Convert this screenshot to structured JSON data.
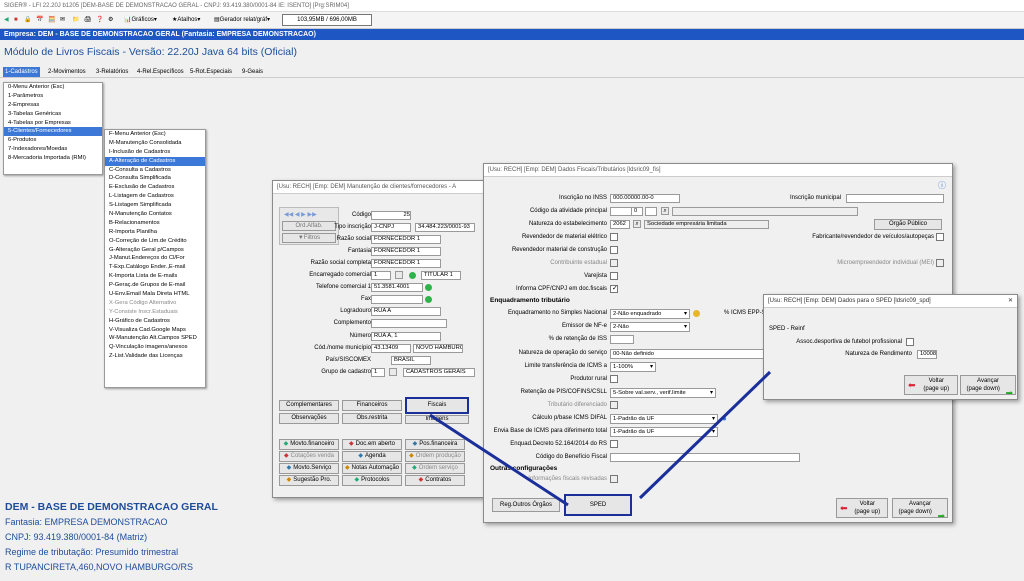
{
  "window_title": "SIGER® - LFI 22.20J b1205 [DEM-BASE DE DEMONSTRACAO GERAL - CNPJ: 93.419.380/0001-84 IE: ISENTO] [Prg:SRIM04]",
  "toolbar": {
    "graficos": "Gráficos",
    "atalhos": "Atalhos",
    "gerador": "Gerador relat/gráf",
    "memory": "103,95MB / 696,00MB"
  },
  "empresa_bar": "Empresa:  DEM - BASE DE DEMONSTRACAO GERAL (Fantasia: EMPRESA DEMONSTRACAO)",
  "module_title": "Módulo de Livros Fiscais - Versão: 22.20J Java 64 bits (Oficial)",
  "menubar": [
    "1-Cadastros",
    "2-Movimentos",
    "3-Relatórios",
    "4-Rel.Específicos",
    "5-Rot.Especiais",
    "9-Geais"
  ],
  "menu1": [
    "0-Menu Anterior (Esc)",
    "1-Parâmetros",
    "2-Empresas",
    "3-Tabelas Genéricas",
    "4-Tabelas por Empresas",
    "5-Clientes/Fornecedores",
    "6-Produtos",
    "7-Indexadores/Moedas",
    "8-Mercadoria Importada (RMI)"
  ],
  "menu2": [
    "F-Menu Anterior (Esc)",
    "M-Manutenção Consolidada",
    "I-Inclusão de Cadastros",
    "A-Alteração de Cadastros",
    "C-Consulta a Cadastros",
    "D-Consulta Simplificada",
    "E-Exclusão de Cadastros",
    "L-Listagem de Cadastros",
    "S-Listagem Simplificada",
    "N-Manutenção Contatos",
    "B-Relacionamentos",
    "R-Importa Planilha",
    "O-Correção de Lim.de Crédito",
    "G-Alteração Geral p/Campos",
    "J-Manut.Endereços do Cl/For",
    "T-Exp.Catálogo Ender.,E-mail",
    "K-Importa Lista de E-mails",
    "P-Geraç.de Grupos de E-mail",
    "U-Env.Email Mala Direta HTML",
    "X-Gera Código Alternativo",
    "Y-Consiste Inscr.Estaduais",
    "H-Gráfico de Cadastros",
    "V-Visualiza Cad.Google Maps",
    "W-Manutenção Alt.Campos SPED",
    "Q-Vinculação imagens/anexos",
    "Z-List.Validade das Licenças"
  ],
  "info": {
    "name": "DEM - BASE DE DEMONSTRACAO GERAL",
    "fantasia": "Fantasia: EMPRESA DEMONSTRACAO",
    "cnpj": "CNPJ: 93.419.380/0001-84 (Matriz)",
    "regime": "Regime de tributação: Presumido trimestral",
    "endereco": "R TUPANCIRETA,460,NOVO HAMBURGO/RS"
  },
  "w1": {
    "title": "[Usu: RECH] [Emp: DEM] Manutenção de clientes/fornecedores - A",
    "ord_alfab": "Ord.Alfab.",
    "filtros": "Filtros",
    "fields": [
      {
        "label": "Código",
        "value": "25"
      },
      {
        "label": "Tipo inscrição",
        "value": "J-CNPJ",
        "value2": "34.484.223/0001-93"
      },
      {
        "label": "Razão social",
        "value": "FORNECEDOR 1"
      },
      {
        "label": "Fantasia",
        "value": "FORNECEDOR 1"
      },
      {
        "label": "Razão social completa",
        "value": "FORNECEDOR 1"
      },
      {
        "label": "Encarregado comercial",
        "value": "1",
        "value2": "TITULAR 1"
      },
      {
        "label": "Telefone comercial 1",
        "value": "51.3581.4001"
      },
      {
        "label": "Fax",
        "value": ""
      },
      {
        "label": "Logradouro",
        "value": "RUA A"
      },
      {
        "label": "Complemento",
        "value": ""
      },
      {
        "label": "Número",
        "value": "RUA A, 1"
      },
      {
        "label": "Cód./nome município",
        "value": "43.13409",
        "value2": "NOVO HAMBURGO"
      },
      {
        "label": "País/SISCOMEX",
        "value": "BRASIL"
      },
      {
        "label": "Grupo de cadastro",
        "value": "1",
        "value2": "CADASTROS GERAIS"
      }
    ],
    "tabs1": [
      "Complementares",
      "Financeiros",
      "Fiscais"
    ],
    "tabs2": [
      "Observações",
      "Obs.restrita",
      "Imagens"
    ],
    "actions": [
      [
        "Movto.financeiro",
        "Doc.em aberto",
        "Pos.financeira"
      ],
      [
        "Cotações venda",
        "Agenda",
        "Ordem produção"
      ],
      [
        "Movto.Serviço",
        "Notas Automação",
        "Ordem serviço"
      ],
      [
        "Sugestão Pro.",
        "Protocolos",
        "Contratos"
      ]
    ]
  },
  "w2": {
    "title": "[Usu: RECH] [Emp: DEM] Dados Fiscais/Tributários [ldsric09_fis]",
    "inss_label": "Inscrição no INSS",
    "inss_value": "000.00000.00-0",
    "insc_mun_label": "Inscrição municipal",
    "ativ_label": "Código da atividade principal",
    "ativ_value": "0",
    "nat_label": "Natureza do estabelecimento",
    "nat_code": "2062",
    "nat_value": "Sociedade empresária limitada",
    "orgao_publico": "Órgão Público",
    "rev_eletrico": "Revendedor de material elétrico",
    "fabricante": "Fabricante/revendedor de veículos/autopeças",
    "rev_construcao": "Revendedor material de construção",
    "contrib_estadual": "Contribuinte estadual",
    "mei": "Microempreendedor individual (MEI)",
    "varejista": "Varejista",
    "informa_cpf": "Informa CPF/CNPJ em doc.fiscais",
    "enq_title": "Enquadramento tributário",
    "simples_label": "Enquadramento no Simples Nacional",
    "simples_value": "2-Não enquadrado",
    "icms_epp": "% ICMS EPP-Sim",
    "nfe_label": "Emissor de NF-e",
    "nfe_value": "2-Não",
    "iss_label": "% de retenção de ISS",
    "natop_label": "Natureza de operação do serviço",
    "natop_value": "00-Não definido",
    "limite_label": "Limite transferência de ICMS a",
    "limite_value": "1-100%",
    "produtor": "Produtor rural",
    "pis_label": "Retenção de PIS/COFINS/CSLL",
    "pis_value": "5-Sobre val.serv., verif.limite",
    "trib_dif": "Tributário diferenciado",
    "difal_label": "Cálculo p/base ICMS DIFAL",
    "difal_value": "1-Padrão da UF",
    "envia_label": "Envia Base de ICMS para diferimento total",
    "envia_value": "1-Padrão da UF",
    "decreto": "Enquad.Decreto 52.164/2014 do RS",
    "beneficio": "Código do Benefício Fiscal",
    "outras_title": "Outras configurações",
    "info_revisadas": "Informações fiscais revisadas",
    "reg_orgaos": "Reg.Outros Órgãos",
    "sped": "SPED",
    "voltar": "Voltar\n(page up)",
    "avancar": "Avançar\n(page down)"
  },
  "w3": {
    "title": "[Usu: RECH] [Emp: DEM] Dados para o SPED [ldsric09_spd]",
    "section": "SPED - Reinf",
    "assoc": "Assoc.desportiva de futebol profissional",
    "nat_rend_label": "Natureza de Rendimento",
    "nat_rend_value": "10008",
    "voltar": "Voltar\n(page up)",
    "avancar": "Avançar\n(page down)"
  }
}
